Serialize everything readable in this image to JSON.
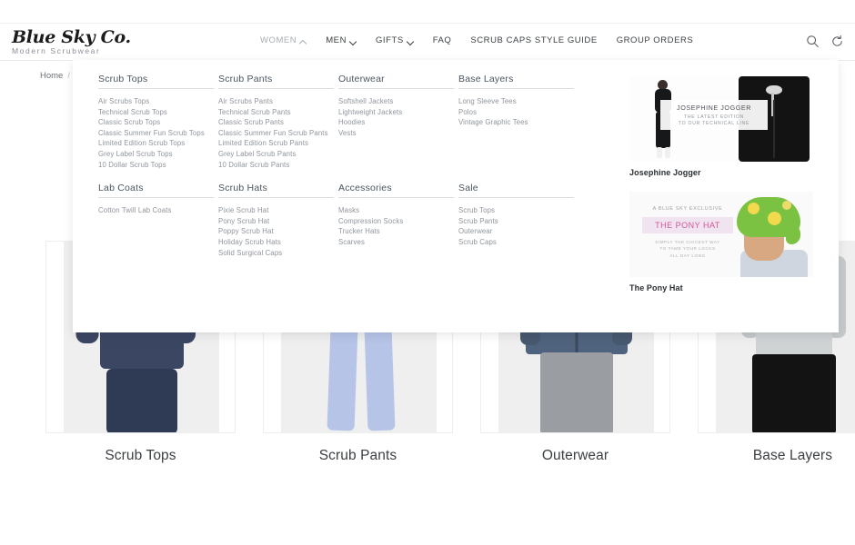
{
  "site": {
    "logo_main": "Blue Sky Co.",
    "logo_sub": "Modern Scrubwear"
  },
  "header": {
    "nav": [
      {
        "label": "WOMEN",
        "icon": "chevron-up-icon",
        "expanded": true
      },
      {
        "label": "MEN",
        "icon": "chevron-down-icon",
        "expanded": false
      },
      {
        "label": "GIFTS",
        "icon": "chevron-down-icon",
        "expanded": false
      },
      {
        "label": "FAQ",
        "icon": "",
        "expanded": false
      },
      {
        "label": "SCRUB CAPS STYLE GUIDE",
        "icon": "",
        "expanded": false
      },
      {
        "label": "GROUP ORDERS",
        "icon": "",
        "expanded": false
      }
    ],
    "icons": [
      {
        "name": "search-icon"
      },
      {
        "name": "refresh-icon"
      }
    ]
  },
  "breadcrumb": {
    "home": "Home",
    "separator": "/"
  },
  "dropdown": {
    "columns": [
      {
        "heading": "Scrub Tops",
        "items": [
          "Air Scrubs Tops",
          "Technical Scrub Tops",
          "Classic Scrub Tops",
          "Classic Summer Fun Scrub Tops",
          "Limited Edition Scrub Tops",
          "Grey Label Scrub Tops",
          "10 Dollar Scrub Tops"
        ]
      },
      {
        "heading": "Scrub Pants",
        "items": [
          "Air Scrubs Pants",
          "Technical Scrub Pants",
          "Classic Scrub Pants",
          "Classic Summer Fun Scrub Pants",
          "Limited Edition Scrub Pants",
          "Grey Label Scrub Pants",
          "10 Dollar Scrub Pants"
        ]
      },
      {
        "heading": "Outerwear",
        "items": [
          "Softshell Jackets",
          "Lightweight Jackets",
          "Hoodies",
          "Vests"
        ]
      },
      {
        "heading": "Base Layers",
        "items": [
          "Long Sleeve Tees",
          "Polos",
          "Vintage Graphic Tees"
        ]
      },
      {
        "heading": "Lab Coats",
        "items": [
          "Cotton Twill Lab Coats"
        ]
      },
      {
        "heading": "Scrub Hats",
        "items": [
          "Pixie Scrub Hat",
          "Pony Scrub Hat",
          "Poppy Scrub Hat",
          "Holiday Scrub Hats",
          "Solid Surgical Caps"
        ]
      },
      {
        "heading": "Accessories",
        "items": [
          "Masks",
          "Compression Socks",
          "Trucker Hats",
          "Scarves"
        ]
      },
      {
        "heading": "Sale",
        "items": [
          "Scrub Tops",
          "Scrub Pants",
          "Outerwear",
          "Scrub Caps"
        ]
      }
    ],
    "promos": [
      {
        "caption": "Josephine Jogger",
        "overlay_title": "JOSEPHINE JOGGER",
        "overlay_line1": "THE LATEST EDITION",
        "overlay_line2": "TO OUR TECHNICAL LINE"
      },
      {
        "caption": "The Pony Hat",
        "eyebrow": "A BLUE SKY EXCLUSIVE",
        "title": "THE PONY HAT",
        "sub_line1": "SIMPLY THE CHICEST WAY",
        "sub_line2": "TO TAME YOUR LOCKS",
        "sub_line3": "ALL DAY LONG"
      }
    ]
  },
  "cards": [
    {
      "label": "Scrub Tops"
    },
    {
      "label": "Scrub Pants"
    },
    {
      "label": "Outerwear"
    },
    {
      "label": "Base Layers"
    }
  ],
  "colors": {
    "navy_top": "#3b4663",
    "periwinkle_pants": "#b6c4e8",
    "denim_jacket": "#4f637e",
    "grey_pants": "#9a9da1",
    "grey_tee": "#c6cacb",
    "black": "#131314",
    "pink_accent": "#d6569a",
    "lavender_band": "#efe4f0",
    "hat_green": "#7cc242"
  }
}
